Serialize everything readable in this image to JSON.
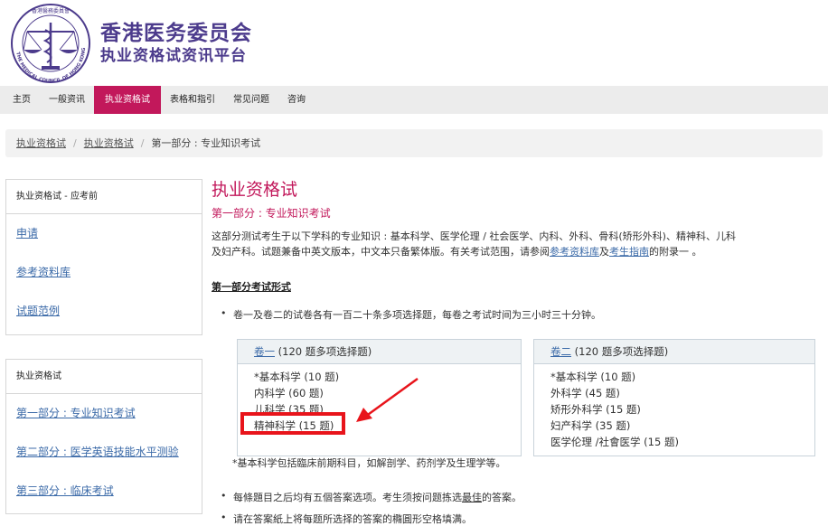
{
  "header": {
    "title": "香港医务委员会",
    "subtitle": "执业资格试资讯平台",
    "logo_ring_text": "THE MEDICAL COUNCIL OF HONG KONG",
    "logo_top_text": "香港醫務委員會"
  },
  "nav": {
    "items": [
      {
        "label": "主页"
      },
      {
        "label": "一般资讯"
      },
      {
        "label": "执业资格试"
      },
      {
        "label": "表格和指引"
      },
      {
        "label": "常见问题"
      },
      {
        "label": "咨询"
      }
    ]
  },
  "breadcrumb": {
    "items": [
      "执业资格试",
      "执业资格试",
      "第一部分 : 专业知识考试"
    ]
  },
  "sidebar": {
    "box1": {
      "heading": "执业资格试 - 应考前",
      "links": [
        "申请",
        "参考资料库",
        "试题范例"
      ]
    },
    "box2": {
      "heading": "执业资格试",
      "links": [
        "第一部分 : 专业知识考试",
        "第二部分 : 医学英语技能水平测验",
        "第三部分 : 临床考试"
      ]
    }
  },
  "main": {
    "title": "执业资格试",
    "subtitle": "第一部分 : 专业知识考试",
    "intro_1": "这部分测试考生于以下学科的专业知识 : 基本科学、医学伦理 / 社会医学、内科、外科、骨科(矫形外科)、精神科、儿科",
    "intro_2": "及妇产科。试题兼备中英文版本，中文本只备繁体版。有关考试范围，请参阅",
    "link_ref": "参考资料库",
    "and": "及",
    "link_guide": "考生指南",
    "intro_3": "的附录一 。",
    "format_heading": "第一部分考试形式",
    "bullet_1": "卷一及卷二的试卷各有一百二十条多项选择题，每卷之考试时间为三小时三十分钟。",
    "paper1": {
      "vol": "卷一",
      "count": "(120 题多项选择题)",
      "rows": [
        "*基本科学 (10 题)",
        "内科学 (60 题)",
        "儿科学 (35 题)",
        "精神科学 (15 题)"
      ]
    },
    "paper2": {
      "vol": "卷二",
      "count": "(120 题多项选择题)",
      "rows": [
        "*基本科学 (10 题)",
        "外科学 (45 题)",
        "矫形外科学 (15 题)",
        "妇产科学 (35 题)",
        "医学伦理 /社會医学 (15 题)"
      ]
    },
    "note": "*基本科学包括臨床前期科目，如解剖学、药剂学及生理学等。",
    "bullet_2_a": "每條題目之后均有五個答案选项。考生须按问题拣选",
    "bullet_2_b": "最佳",
    "bullet_2_c": "的答案。",
    "bullet_3": "请在答案紙上将每题所选择的答案的橢圓形空格填满。"
  },
  "colors": {
    "accent": "#c2185b",
    "brand": "#4c3b8c",
    "link": "#3b6aa8",
    "highlight": "#e8141b"
  }
}
